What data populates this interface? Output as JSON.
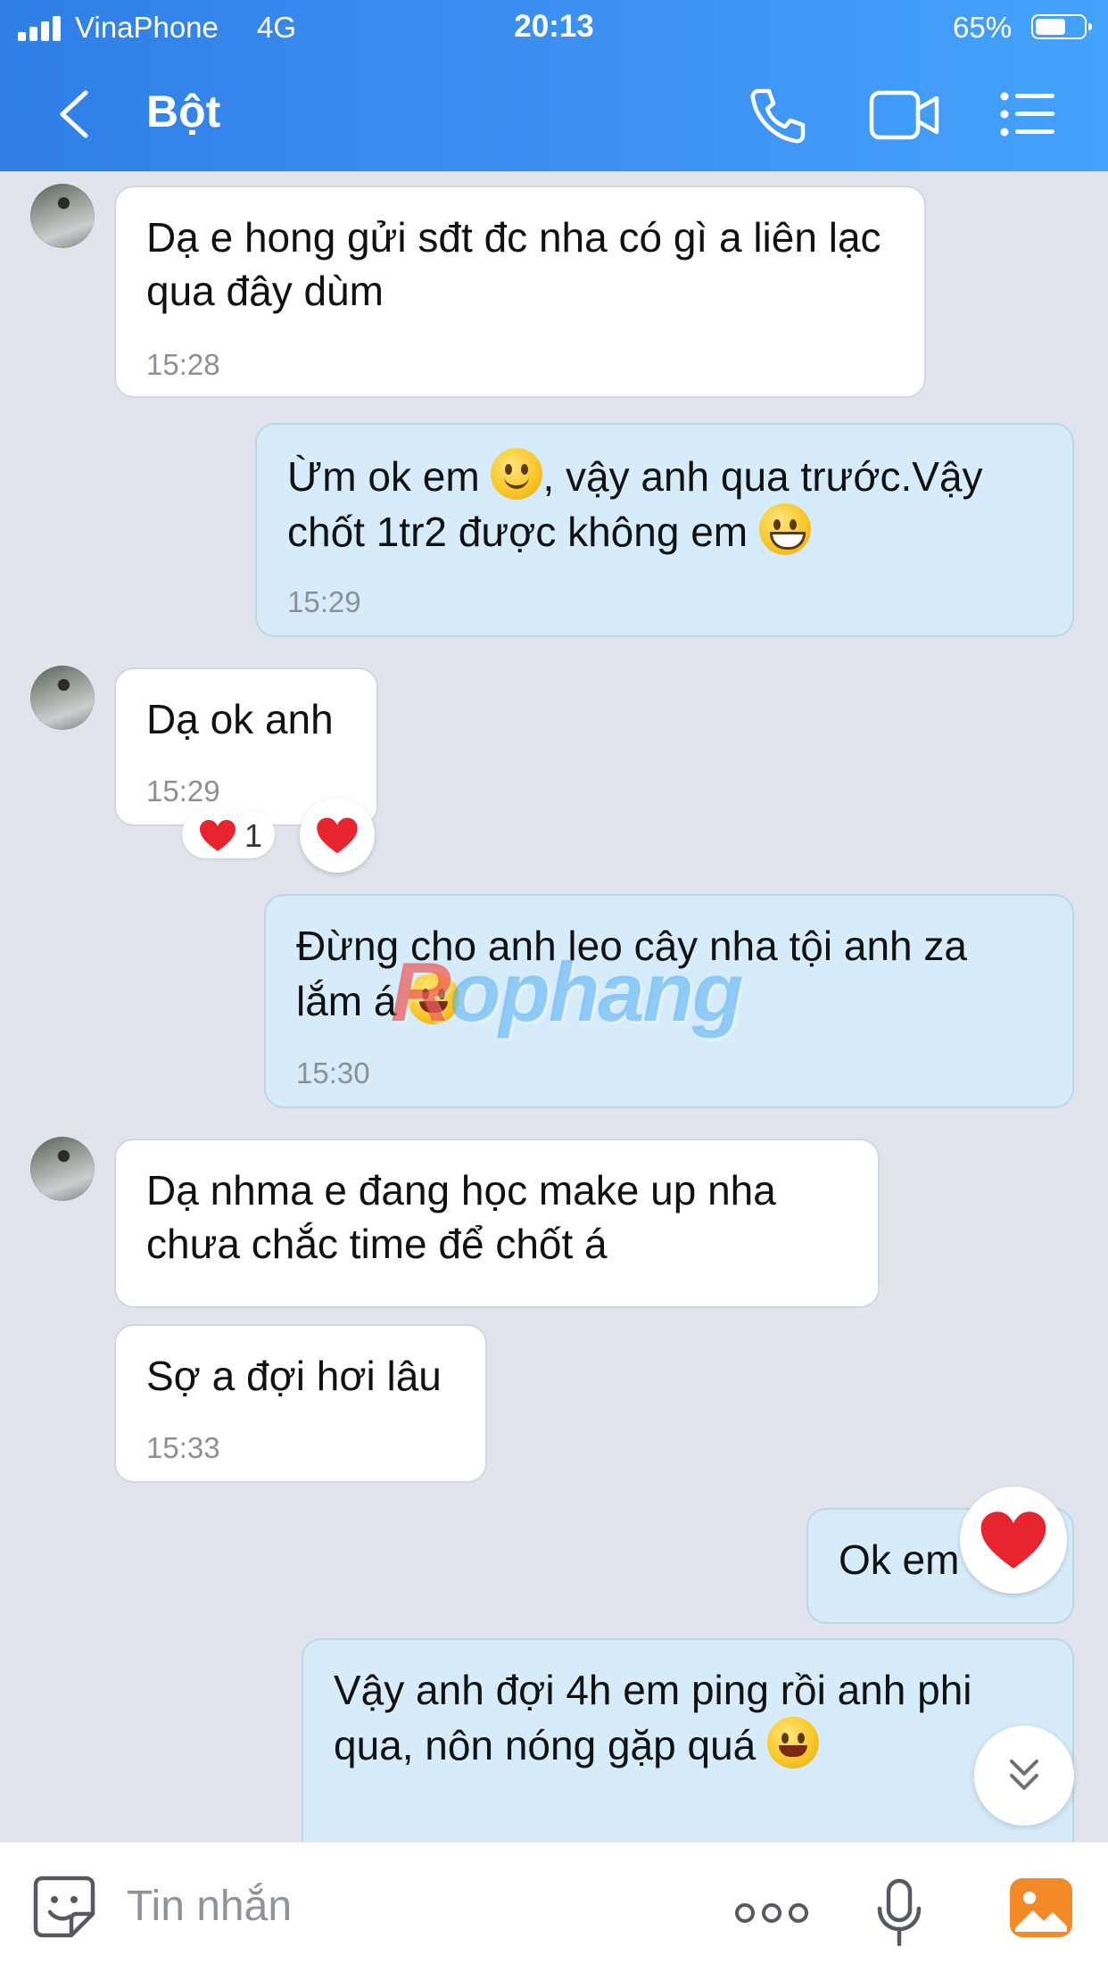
{
  "status_bar": {
    "carrier": "VinaPhone",
    "network": "4G",
    "time": "20:13",
    "battery_percent": "65%",
    "battery_level": 0.65
  },
  "header": {
    "title": "Bột",
    "icons": [
      "back-icon",
      "phone-icon",
      "video-call-icon",
      "menu-icon"
    ]
  },
  "messages": [
    {
      "from": "them",
      "text": "Dạ e hong gửi sđt đc nha có gì a liên lạc qua đây dùm",
      "time": "15:28"
    },
    {
      "from": "me",
      "text_a": "Ừm ok em ",
      "text_b": ", vậy anh qua trước.Vậy chốt 1tr2 được không em ",
      "time": "15:29",
      "emojis": [
        "slightly-smiling-face",
        "grinning-face"
      ]
    },
    {
      "from": "them",
      "text": "Dạ ok anh",
      "time": "15:29",
      "reaction_count": "1"
    },
    {
      "from": "me",
      "text_a": "Đừng cho anh leo cây nha tội anh za lắm á ",
      "time": "15:30",
      "emojis": [
        "face-with-tears-of-joy"
      ]
    },
    {
      "from": "them",
      "text": "Dạ nhma e đang học make up nha chưa chắc time để chốt á"
    },
    {
      "from": "them",
      "text": "Sợ a đợi hơi lâu",
      "time": "15:33"
    },
    {
      "from": "me",
      "text": "Ok em"
    },
    {
      "from": "me",
      "text_a": "Vậy anh đợi 4h em ping rồi anh phi qua, nôn nóng gặp quá ",
      "emojis": [
        "face-with-tears-of-joy"
      ]
    }
  ],
  "watermark": {
    "part1": "R",
    "part2": "ophang"
  },
  "composer": {
    "placeholder": "Tin nhắn",
    "icons": [
      "sticker-icon",
      "more-icon",
      "microphone-icon",
      "image-icon"
    ]
  },
  "colors": {
    "header_start": "#2f7fe6",
    "header_end": "#44a2fb",
    "background": "#e1e4ec",
    "incoming_bubble": "#ffffff",
    "outgoing_bubble": "#d6ecfb",
    "heart": "#e8242f"
  }
}
